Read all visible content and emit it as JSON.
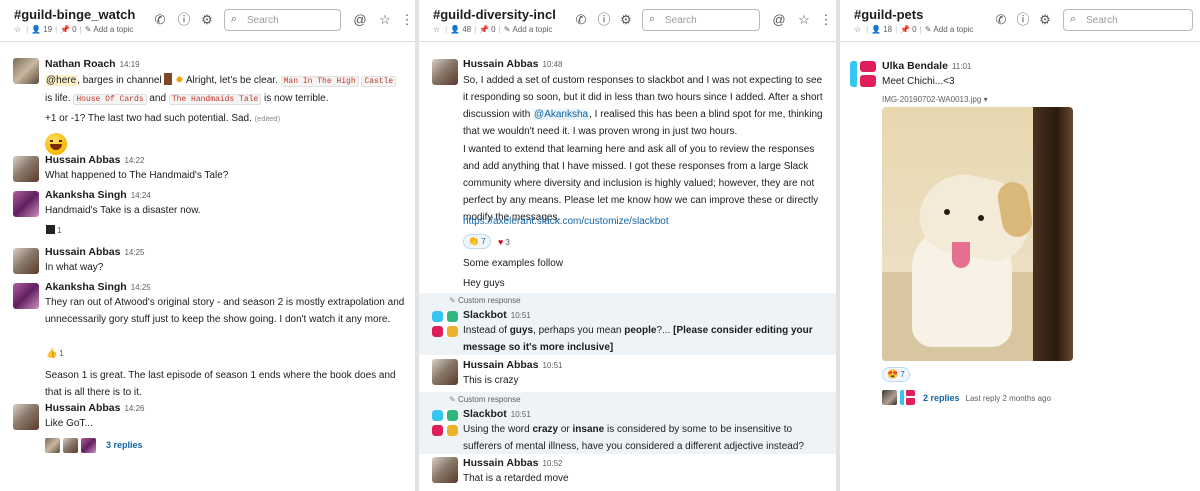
{
  "colors": {
    "link": "#1264a3",
    "slack_red": "#e01e5a",
    "slack_blue": "#36c5f0",
    "slack_green": "#2eb67d",
    "slack_yellow": "#ecb22e"
  },
  "icons": {
    "star": "star-icon",
    "members": "person-icon",
    "pins": "pin-icon",
    "topic": "pencil-icon",
    "call": "phone-icon",
    "info": "info-icon",
    "settings": "gear-icon",
    "search": "search-icon",
    "mentions": "at-icon",
    "starred": "star-outline-icon",
    "more": "kebab-icon"
  },
  "channels": [
    {
      "name": "#guild-binge_watch",
      "members": "19",
      "pins": "0",
      "add_topic": "Add a topic",
      "search_placeholder": "Search",
      "messages": [
        {
          "author": "Nathan Roach",
          "time": "14:19",
          "mention": "@here",
          "t1": ", barges in channel",
          "t2": "Alright, let's be clear.",
          "code1": "Man In The High",
          "code2": "Castle",
          "t3": "is life.",
          "code3": "House Of Cards",
          "t4": "and",
          "code4": "The Handmaids Tale",
          "t5": "is now terrible.",
          "t6": "+1 or -1? The last two had such potential. Sad.",
          "edited": "(edited)"
        },
        {
          "author": "Hussain Abbas",
          "time": "14:22",
          "text": "What happened to The Handmaid's Tale?"
        },
        {
          "author": "Akanksha Singh",
          "time": "14:24",
          "text": "Handmaid's Take is a disaster now.",
          "reaction": "1"
        },
        {
          "author": "Hussain Abbas",
          "time": "14:25",
          "text": "In what way?"
        },
        {
          "author": "Akanksha Singh",
          "time": "14:25",
          "text": "They ran out of Atwood's original story - and season 2 is mostly extrapolation and unnecessarily gory stuff just to keep the show going. I don't watch it any more.",
          "reaction": "1",
          "text2": "Season 1 is great. The last episode of season 1 ends where the book does and that is all there is to it."
        },
        {
          "author": "Hussain Abbas",
          "time": "14:26",
          "text": "Like GoT...",
          "replies": "3 replies"
        }
      ]
    },
    {
      "name": "#guild-diversity-incl",
      "members": "48",
      "pins": "0",
      "add_topic": "Add a topic",
      "search_placeholder": "Search",
      "messages": [
        {
          "author": "Hussain Abbas",
          "time": "10:48",
          "p1a": "So, I added a set of custom responses to slackbot and I was not expecting to see it responding so soon, but it did in less than two hours since I added. After a short discussion with",
          "p1m": "@Akanksha",
          "p1b": ", I realised this has been a blind spot for me, thinking that we wouldn't need it. I was proven wrong in just two hours.",
          "p2": "I wanted to extend that learning here and ask all of you to review the responses and add anything that I have missed. I got these responses from a large Slack community where diversity and inclusion is highly valued; however, they are not perfect by any means. Please let me know how we can improve these or directly modify the messages.",
          "url": "https://axelerant.slack.com/customize/slackbot",
          "r1": "7",
          "r2": "3",
          "p3": "Some examples follow",
          "p4": "Hey guys"
        },
        {
          "custom": "Custom response",
          "author": "Slackbot",
          "time": "10:51",
          "a": "Instead of",
          "b": "guys",
          "c": ", perhaps you mean",
          "d": "people",
          "e": "?...",
          "f": "[Please consider editing your message so it's more inclusive]"
        },
        {
          "author": "Hussain Abbas",
          "time": "10:51",
          "text": "This is crazy"
        },
        {
          "custom": "Custom response",
          "author": "Slackbot",
          "time": "10:51",
          "a": "Using the word",
          "b": "crazy",
          "c": "or",
          "d": "insane",
          "e": "is considered by some to be insensitive to sufferers of mental illness, have you considered a different adjective instead?"
        },
        {
          "author": "Hussain Abbas",
          "time": "10:52",
          "text": "That is a retarded move"
        }
      ]
    },
    {
      "name": "#guild-pets",
      "members": "18",
      "pins": "0",
      "add_topic": "Add a topic",
      "search_placeholder": "Search",
      "messages": [
        {
          "author": "Ulka Bendale",
          "time": "11:01",
          "text": "Meet Chichi...<3",
          "file": "IMG-20190702-WA0013.jpg",
          "reaction": "7",
          "replies": "2 replies",
          "last_reply": "Last reply 2 months ago"
        }
      ]
    }
  ]
}
